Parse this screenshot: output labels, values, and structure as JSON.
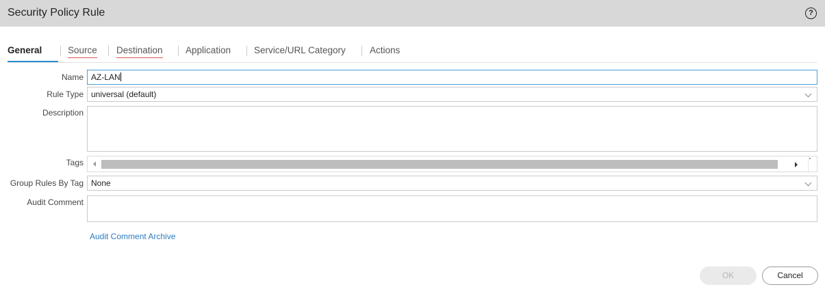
{
  "dialog": {
    "title": "Security Policy Rule",
    "help_icon": "?"
  },
  "tabs": [
    {
      "label": "General",
      "active": true
    },
    {
      "label": "Source",
      "has_error": true
    },
    {
      "label": "Destination",
      "has_error": true
    },
    {
      "label": "Application"
    },
    {
      "label": "Service/URL Category"
    },
    {
      "label": "Actions"
    }
  ],
  "form": {
    "name": {
      "label": "Name",
      "value": "AZ-LAN"
    },
    "rule_type": {
      "label": "Rule Type",
      "value": "universal (default)"
    },
    "description": {
      "label": "Description",
      "value": ""
    },
    "tags": {
      "label": "Tags"
    },
    "group_rules_by_tag": {
      "label": "Group Rules By Tag",
      "value": "None"
    },
    "audit_comment": {
      "label": "Audit Comment",
      "value": ""
    },
    "audit_archive_link": "Audit Comment Archive"
  },
  "footer": {
    "ok_label": "OK",
    "cancel_label": "Cancel"
  },
  "colors": {
    "accent": "#2a8fd0",
    "error_underline": "#d9534f",
    "link": "#2b7bbf",
    "titlebar": "#d8d8d8"
  }
}
